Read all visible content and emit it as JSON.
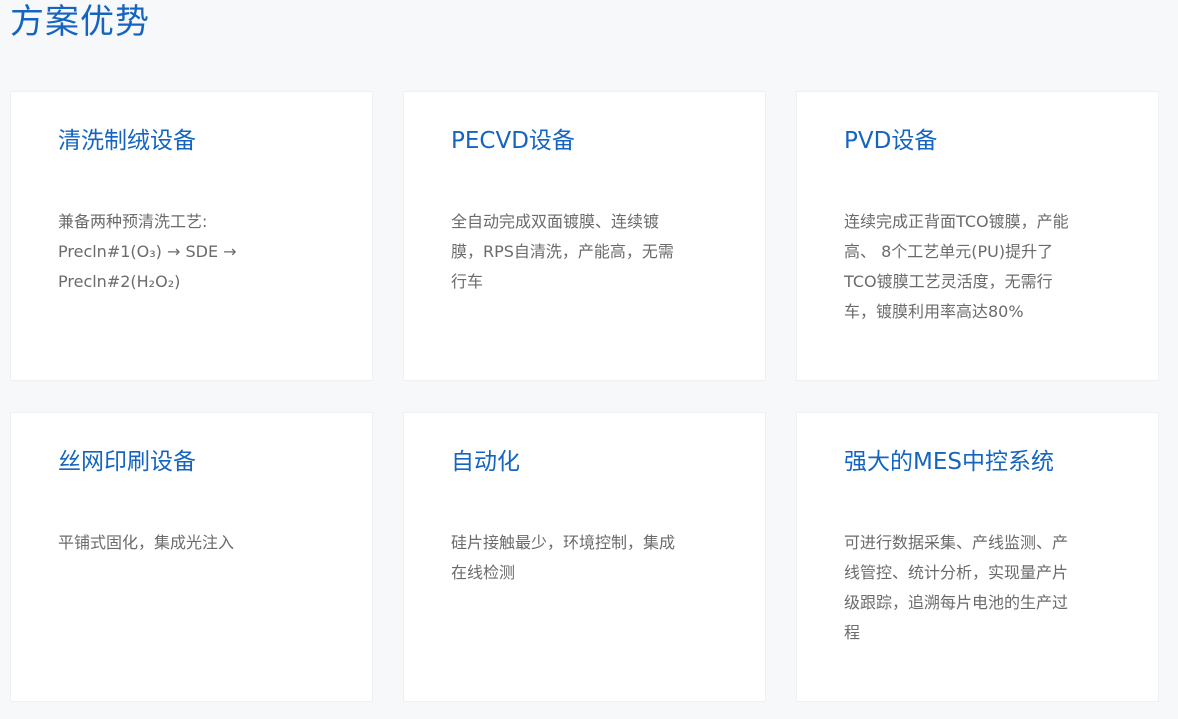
{
  "page_title": "方案优势",
  "cards": [
    {
      "title": "清洗制绒设备",
      "desc_lines": [
        "兼备两种预清洗工艺:",
        "Precln#1(O₃) → SDE →",
        "Precln#2(H₂O₂)"
      ]
    },
    {
      "title": "PECVD设备",
      "desc_lines": [
        "全自动完成双面镀膜、连续镀",
        "膜，RPS自清洗，产能高，无需",
        "行车"
      ]
    },
    {
      "title": "PVD设备",
      "desc_lines": [
        "连续完成正背面TCO镀膜，产能",
        "高、 8个工艺单元(PU)提升了",
        "TCO镀膜工艺灵活度，无需行",
        "车，镀膜利用率高达80%"
      ]
    },
    {
      "title": "丝网印刷设备",
      "desc_lines": [
        "平铺式固化，集成光注入"
      ]
    },
    {
      "title": "自动化",
      "desc_lines": [
        "硅片接触最少，环境控制，集成",
        "在线检测"
      ]
    },
    {
      "title": "强大的MES中控系统",
      "desc_lines": [
        "可进行数据采集、产线监测、产",
        "线管控、统计分析，实现量产片",
        "级跟踪，追溯每片电池的生产过",
        "程"
      ]
    }
  ]
}
